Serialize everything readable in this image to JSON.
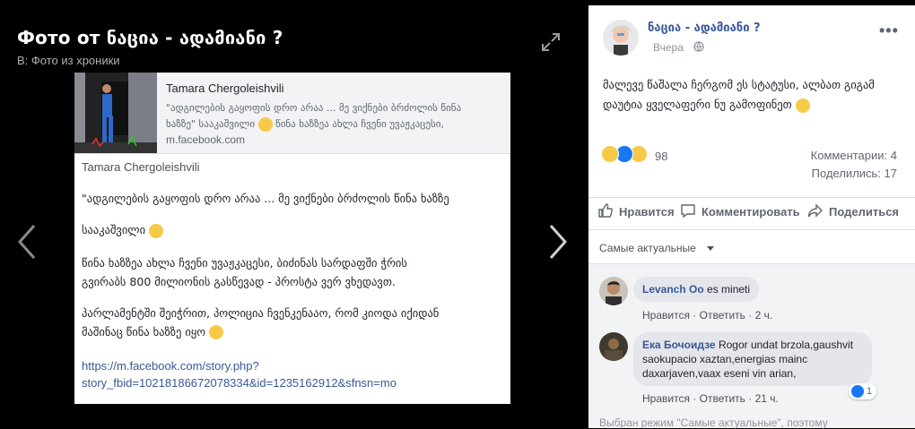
{
  "viewer": {
    "title": "Фото от ნაცია - ადამიანი ?",
    "subtitle": "В: Фото из хроники"
  },
  "photo": {
    "preview": {
      "author": "Tamara Chergoleishvili",
      "snippet_line1": "\"ადგილების გაყოფის დრო არაა ... მე ვიქნები ბრძოლის წინა",
      "snippet_line2": "ხაზზე\" სააკაშვილი",
      "snippet_line2b": "წინა ხაზზეა ახლა ჩვენი უვაჟკაცესი,",
      "domain": "m.facebook.com"
    },
    "body": {
      "author": "Tamara Chergoleishvili",
      "para1": "\"ადგილების გაყოფის დრო არაა ... მე ვიქნები ბრძოლის წინა ხაზზე",
      "para2": "სააკაშვილი",
      "para3_line1": "წინა ხაზზეა ახლა ჩვენი უვაჟკაცესი, ბიძინას სარდაფში ჭრის",
      "para3_line2": "გვირაბს 800 მილიონის გასწევად - პროსტა ვერ ვხედავთ.",
      "para4_line1": "პარლამენტში შეიჭრით, პოლიცია ჩვენკენააო, რომ კიოდა იქიდან",
      "para4_line2": "მაშინაც წინა ხაზზე იყო",
      "link_line1": "https://m.facebook.com/story.php?",
      "link_line2": "story_fbid=10218186672078334&id=1235162912&sfnsn=mo"
    }
  },
  "post": {
    "author": "ნაცია - ადამიანი ?",
    "date": "Вчера",
    "more": "•••",
    "status": "მალევე წაშალა ჩერგომ ეს სტატუსი, ალბათ გიგამ დაუტია ყველაფერი ნუ გამოფინეთ",
    "reactions_count": "98",
    "comments_count": "Комментарии: 4",
    "shares_count": "Поделились: 17"
  },
  "actions": {
    "like": "Нравится",
    "comment": "Комментировать",
    "share": "Поделиться"
  },
  "sort": {
    "label": "Самые актуальные"
  },
  "comments": [
    {
      "author": "Levanch Oo",
      "text": "es mineti",
      "like": "Нравится",
      "reply": "Ответить",
      "time": "2 ч."
    },
    {
      "author": "Ека Бочоидзе",
      "text_line1": "Rogor undat brzola,gaushvit",
      "text_line2": "saokupacio xaztan,energias mainc",
      "text_line3": "daxarjaven,vaax eseni vin arian,",
      "like": "Нравится",
      "reply": "Ответить",
      "time": "21 ч.",
      "likes": "1"
    }
  ],
  "footer_note": "Выбран режим \"Самые актуальные\", поэтому",
  "colors": {
    "link": "#385898",
    "like_blue": "#1877f2",
    "background": "#000000"
  }
}
